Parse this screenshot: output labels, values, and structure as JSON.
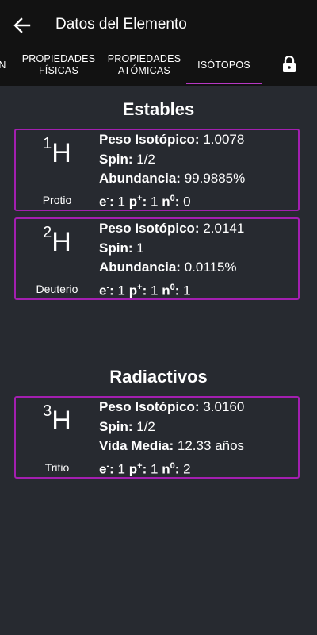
{
  "header": {
    "title": "Datos del Elemento"
  },
  "tabs": [
    {
      "label": "N"
    },
    {
      "label_line1": "PROPIEDADES",
      "label_line2": "FÍSICAS"
    },
    {
      "label_line1": "PROPIEDADES",
      "label_line2": "ATÓMICAS"
    },
    {
      "label": "ISÓTOPOS"
    }
  ],
  "labels": {
    "weight": "Peso Isotópico:",
    "spin": "Spin:",
    "abundance": "Abundancia:",
    "halflife": "Vida Media:",
    "e": "e",
    "e_sup": "-",
    "p": "p",
    "p_sup": "+",
    "n": "n",
    "n_sup": "0"
  },
  "sections": {
    "stable": "Estables",
    "radioactive": "Radiactivos"
  },
  "isotopes": [
    {
      "mass": "1",
      "symbol": "H",
      "name": "Protio",
      "weight": "1.0078",
      "spin": "1/2",
      "abundance": "99.9885%",
      "electrons": "1",
      "protons": "1",
      "neutrons": "0"
    },
    {
      "mass": "2",
      "symbol": "H",
      "name": "Deuterio",
      "weight": "2.0141",
      "spin": "1",
      "abundance": "0.0115%",
      "electrons": "1",
      "protons": "1",
      "neutrons": "1"
    },
    {
      "mass": "3",
      "symbol": "H",
      "name": "Tritio",
      "weight": "3.0160",
      "spin": "1/2",
      "halflife": "12.33 años",
      "electrons": "1",
      "protons": "1",
      "neutrons": "2"
    }
  ],
  "colors": {
    "accent": "#a31fb0",
    "bar": "#121212",
    "background": "#272a30"
  },
  "icons": {
    "back": "arrow-left-icon",
    "lock": "lock-icon"
  }
}
